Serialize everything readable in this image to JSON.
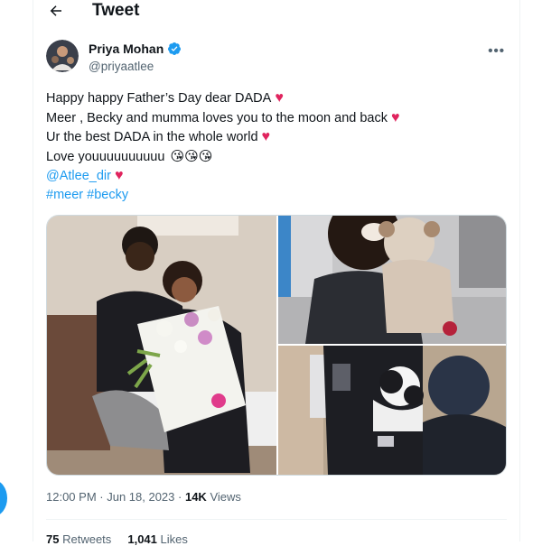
{
  "header": {
    "title": "Tweet",
    "back_icon": "arrow-left-icon"
  },
  "author": {
    "name": "Priya Mohan",
    "handle": "@priyaatlee",
    "verified_icon": "verified-badge-icon",
    "verified_color": "#1d9bf0",
    "more_icon": "more-horizontal-icon"
  },
  "tweet": {
    "line1": "Happy happy Father’s Day dear DADA",
    "line2": "Meer , Becky and mumma loves you to the moon and back",
    "line3": "Ur the best DADA in the whole world",
    "line4": "Love youuuuuuuuuu",
    "kiss_emoji": "😘😘😘",
    "heart_emoji": "♥",
    "mention": "@Atlee_dir",
    "hashtag1": "#meer",
    "hashtag2": "#becky",
    "link_color": "#1d9bf0",
    "heart_color": "#e0245e"
  },
  "media": {
    "photos": [
      "family-photo-with-bouquet",
      "man-holding-baby-photo",
      "man-with-dog-photo"
    ]
  },
  "meta": {
    "time": "12:00 PM",
    "separator": " · ",
    "date": "Jun 18, 2023",
    "views_count": "14K",
    "views_label": "Views"
  },
  "stats": {
    "retweets_count": "75",
    "retweets_label": "Retweets",
    "likes_count": "1,041",
    "likes_label": "Likes"
  }
}
